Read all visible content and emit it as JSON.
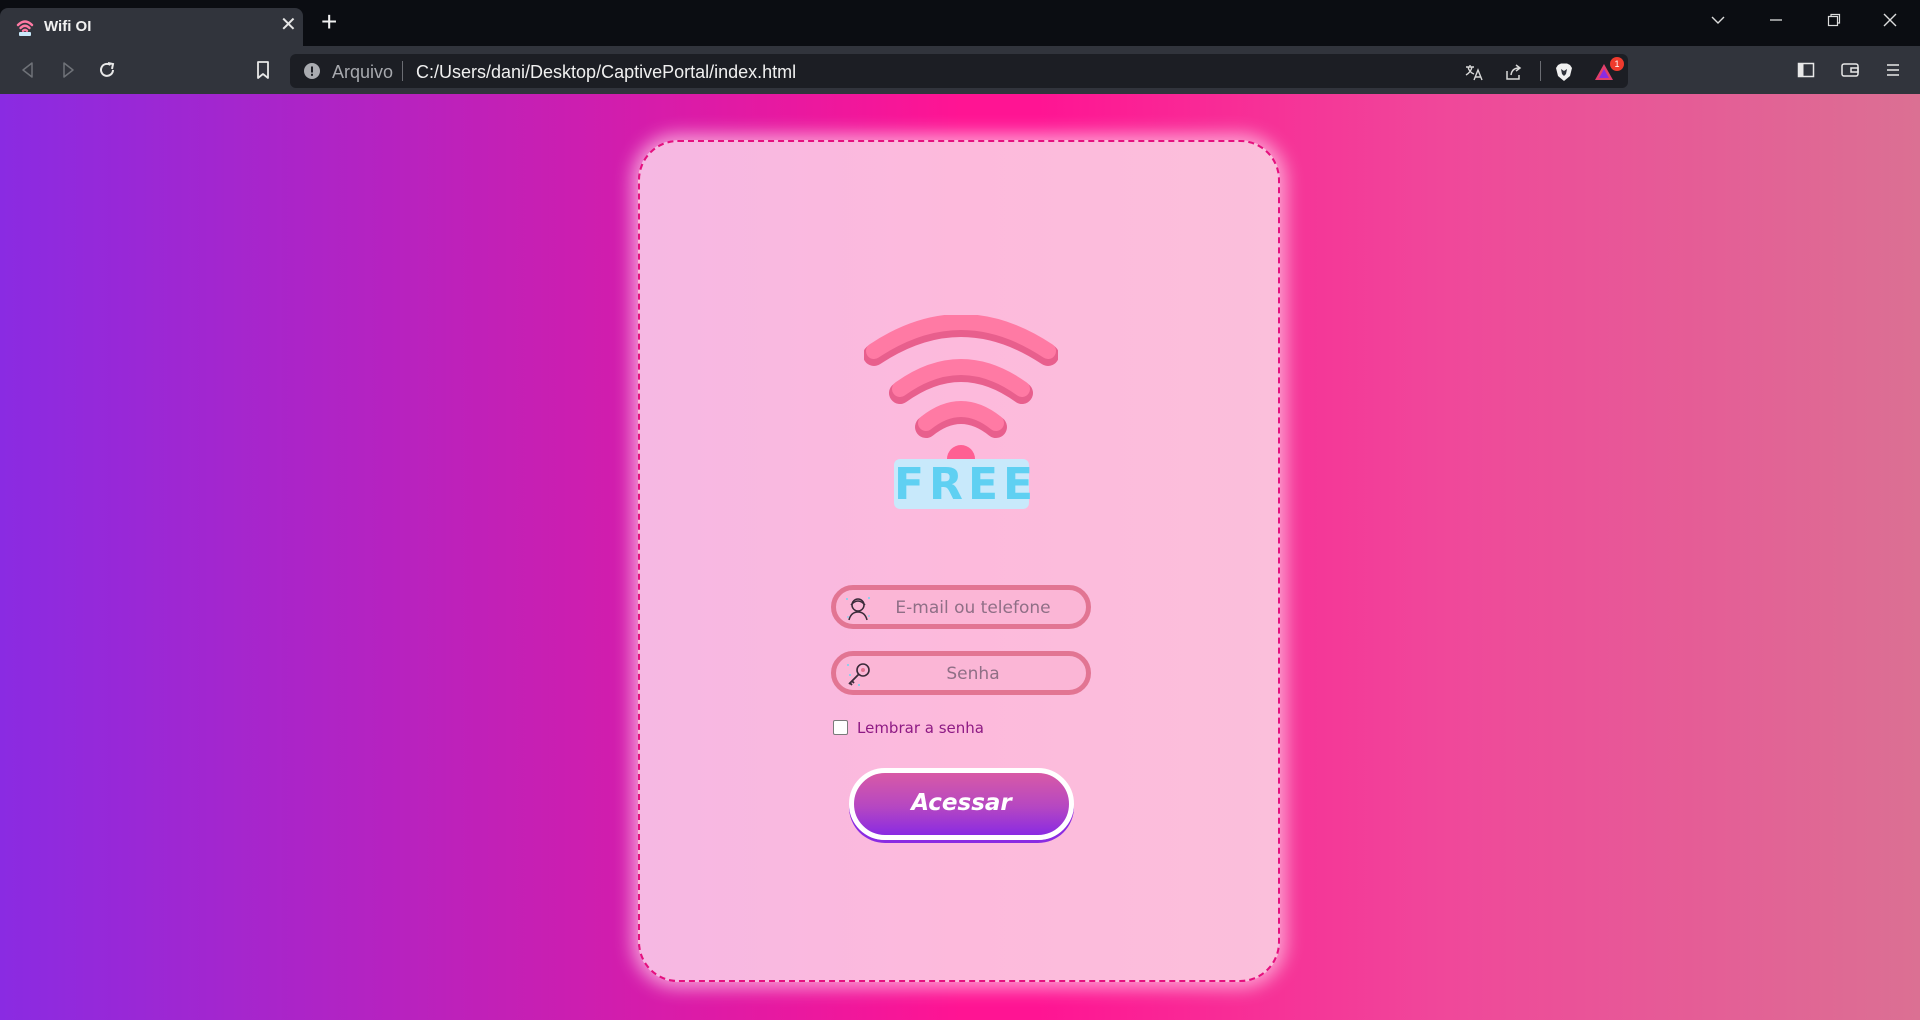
{
  "browser": {
    "tab_title": "Wifi OI",
    "tab_close": "✕",
    "new_tab": "+",
    "address": {
      "scheme_label": "Arquivo",
      "url": "C:/Users/dani/Desktop/CaptivePortal/index.html"
    },
    "rewards_badge_count": "1",
    "icons": [
      "wifi-favicon-icon",
      "back-icon",
      "forward-icon",
      "reload-icon",
      "bookmark-icon",
      "info-icon",
      "translate-icon",
      "share-icon",
      "brave-shield-icon",
      "brave-rewards-icon",
      "sidebar-icon",
      "wallet-icon",
      "menu-icon",
      "chevron-down-icon",
      "minimize-icon",
      "maximize-icon",
      "close-icon"
    ]
  },
  "page": {
    "logo_label": "FREE",
    "email_placeholder": "E-mail ou telefone",
    "password_placeholder": "Senha",
    "remember_label": "Lembrar a senha",
    "submit_label": "Acessar",
    "colors": {
      "gradient_start": "#8a2be2",
      "gradient_mid": "#ff1493",
      "gradient_end": "#db7093",
      "card_border": "#e5107e",
      "wifi_pink": "#ff7aa4",
      "free_blue": "#5fd0f2"
    }
  }
}
